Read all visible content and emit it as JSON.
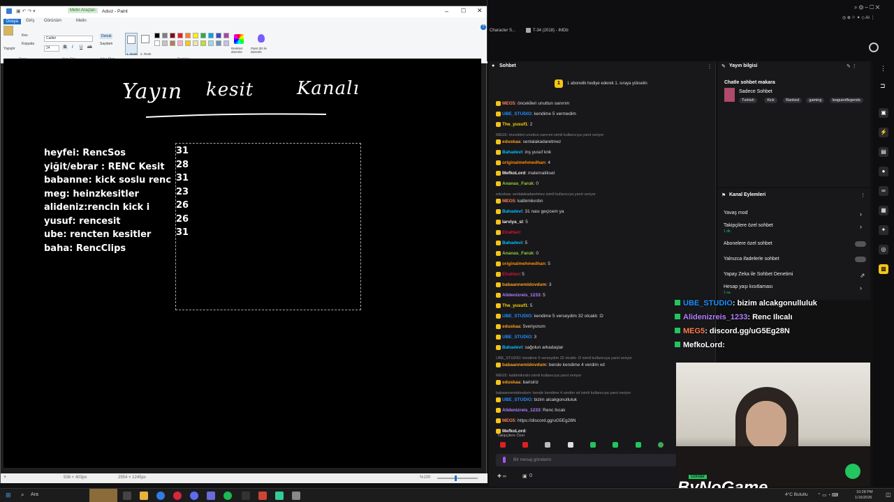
{
  "paint": {
    "title": "Adsız - Paint",
    "context_tab": "Metin Araçları",
    "tabs": [
      "Dosya",
      "Giriş",
      "Görünüm",
      "Metin"
    ],
    "clipboard": {
      "paste": "Yapıştır",
      "cut": "Kes",
      "copy": "Kopyala",
      "group": "Pano"
    },
    "font": {
      "name": "Calibri",
      "size": "24",
      "group": "Yazı Tipi"
    },
    "background": {
      "opaque": "Donuk",
      "transparent": "Saydam",
      "group": "Arka Plan"
    },
    "colors": {
      "color1": "1. Renk",
      "color2": "2. Renk",
      "group": "Renkler",
      "edit": "Renkleri düzenle",
      "paint3d": "Paint 3D ile düzenle"
    },
    "palette": [
      "#000000",
      "#7f7f7f",
      "#880015",
      "#ed1c24",
      "#ff7f27",
      "#fff200",
      "#22b14c",
      "#00a2e8",
      "#3f48cc",
      "#a349a4",
      "#ffffff",
      "#c3c3c3",
      "#b97a57",
      "#ffaec9",
      "#ffc90e",
      "#efe4b0",
      "#b5e61d",
      "#99d9ea",
      "#7092be",
      "#c8bfe7"
    ],
    "canvas": {
      "handwriting": [
        "Yayın",
        "kesit",
        "Kanalı"
      ],
      "list": [
        "heyfei: RencSos",
        "yiğit/ebrar : RENC Kesit",
        "babanne: kick soslu renc",
        "meg: heinzkesitler",
        "alideniz:rencin kick i",
        "yusuf: rencesit",
        "ube: rencten kesitler",
        "baha: RencClips"
      ],
      "numbers": [
        "31",
        "28",
        "31",
        "23",
        "26",
        "26",
        "31"
      ]
    },
    "status": {
      "cursor": "536 × 403px",
      "size": "2554 × 1245px",
      "zoom": "%100"
    }
  },
  "browser": {
    "tabs": [
      "Character S...",
      "T-34 (2018) - IMDb"
    ]
  },
  "chat": {
    "title": "Sohbet",
    "pinned": "1 abonelik hediye ederek 1. sıraya yükselin",
    "messages": [
      {
        "user": "MEG5",
        "color": "#ff7f50",
        "text": ": önceki̇leri unuttun sanırım"
      },
      {
        "user": "UBE_STUDIO",
        "color": "#1e90ff",
        "text": ": kendime 5 vermedim"
      },
      {
        "user": "The_yusuf1",
        "color": "#ffd700",
        "text": ": 2"
      },
      {
        "reply": "MEG5: öncekileri unuttun sanırım isimli kullanıcıya yanıt veriyor"
      },
      {
        "user": "eduskaa",
        "color": "#ff9f1a",
        "text": ": senlalakadaretmez"
      },
      {
        "user": "Bahadevl",
        "color": "#00bfff",
        "text": ": inş yusuf knk"
      },
      {
        "user": "originalmehmedhan",
        "color": "#ff8c00",
        "text": ": 4"
      },
      {
        "user": "MefkoLord",
        "color": "#eeeeee",
        "text": ": matematiksel"
      },
      {
        "user": "Ananas_Faruk",
        "color": "#9acd32",
        "text": ": 0"
      },
      {
        "reply": "eduskaa: senlalakadaretmez isimli kullanıcıya yanıt veriyor"
      },
      {
        "user": "MEG5",
        "color": "#ff7f50",
        "text": ": kalbimikırdın"
      },
      {
        "user": "Bahadevl",
        "color": "#00bfff",
        "text": ": 31 nası geçicem ya"
      },
      {
        "user": "larviya_sl",
        "color": "#eeeeee",
        "text": ": 5"
      },
      {
        "user": "ElraHan",
        "color": "#d2143a",
        "text": ": "
      },
      {
        "user": "Bahadevl",
        "color": "#00bfff",
        "text": ": 5"
      },
      {
        "user": "Ananas_Faruk",
        "color": "#9acd32",
        "text": ": 0"
      },
      {
        "user": "originalmehmedhan",
        "color": "#ff8c00",
        "text": ": 5"
      },
      {
        "user": "ElraHan",
        "color": "#d2143a",
        "text": ": 5"
      },
      {
        "user": "babaannemidovdum",
        "color": "#ff9f1a",
        "text": ": 3"
      },
      {
        "user": "Alidenizreis_1233",
        "color": "#b180ff",
        "text": ": 5"
      },
      {
        "user": "The_yusuf1",
        "color": "#ffd700",
        "text": ": 5"
      },
      {
        "user": "UBE_STUDIO",
        "color": "#1e90ff",
        "text": ": kendime 5 verseydim 32 olcaktı :D"
      },
      {
        "user": "eduskaa",
        "color": "#ff9f1a",
        "text": ": 5veriyorum"
      },
      {
        "user": "UBE_STUDIO",
        "color": "#1e90ff",
        "text": ": 3"
      },
      {
        "user": "Bahadevl",
        "color": "#00bfff",
        "text": ": sağolun arkadaşlar"
      },
      {
        "reply": "UBE_STUDIO: kendime 5 verseydim 32 olcaktı :D isimli kullanıcıya yanıt veriyor"
      },
      {
        "user": "babaannemidovdum",
        "color": "#ff9f1a",
        "text": ": bende kendime 4 verdim xd"
      },
      {
        "reply": "MEG5: kalbimikırdın isimli kullanıcıya yanıt veriyor"
      },
      {
        "user": "eduskaa",
        "color": "#ff9f1a",
        "text": ": barisiriz"
      },
      {
        "reply": "babaannemidovdum: bende kendime 4 verdim xd isimli kullanıcıya yanıt veriyor"
      },
      {
        "user": "UBE_STUDIO",
        "color": "#1e90ff",
        "text": ": bizim alcakgonulluluk"
      },
      {
        "user": "Alidenizreis_1233",
        "color": "#b180ff",
        "text": ": Renc Ilıcalı"
      },
      {
        "user": "MEG5",
        "color": "#ff7f50",
        "text": ": https://discord.gg/uG5Eg28N"
      },
      {
        "user": "MefkoLord",
        "color": "#eeeeee",
        "text": ": "
      }
    ],
    "followers_only": "Takipçilere Özel",
    "input_placeholder": "Bir mesaj gönderin",
    "send": "Gönder",
    "points": "0"
  },
  "stream_info": {
    "title": "Yayın bilgisi",
    "chat_mode": "Chatle sohbet makara",
    "category": "Sadece Sohbet",
    "tags": [
      "Turkish",
      "Kick",
      "Ranked",
      "gaming",
      "leagueoflegends"
    ]
  },
  "channel_actions": {
    "title": "Kanal Eylemleri",
    "items": [
      {
        "label": "Yavaş mod",
        "sub": "",
        "kind": "arrow"
      },
      {
        "label": "Takipçilere özel sohbet",
        "sub": "1 dk.",
        "kind": "arrow"
      },
      {
        "label": "Abonelere özel sohbet",
        "sub": "",
        "kind": "toggle"
      },
      {
        "label": "Yalnızca ifadelerle sohbet",
        "sub": "",
        "kind": "toggle"
      },
      {
        "label": "Yapay Zeka ile Sohbet Denetimi",
        "sub": "",
        "kind": "ext"
      },
      {
        "label": "Hesap yaşı kısıtlaması",
        "sub": "1 sa.",
        "kind": "arrow"
      }
    ]
  },
  "overlay_chat": [
    {
      "user": "UBE_STUDIO",
      "color": "#1e90ff",
      "text": ": bizim alcakgonulluluk"
    },
    {
      "user": "Alidenizreis_1233",
      "color": "#b180ff",
      "text": ": Renc Ilıcalı"
    },
    {
      "user": "MEG5",
      "color": "#ff7f50",
      "text": ": discord.gg/uG5Eg28N"
    },
    {
      "user": "MefkoLord",
      "color": "#ffffff",
      "text": ": "
    }
  ],
  "brand": "ByNoGame",
  "taskbar": {
    "search": "Ara",
    "weather": "4°C Bulutlu",
    "time": "10:28 PM",
    "date": "1/16/2026"
  }
}
